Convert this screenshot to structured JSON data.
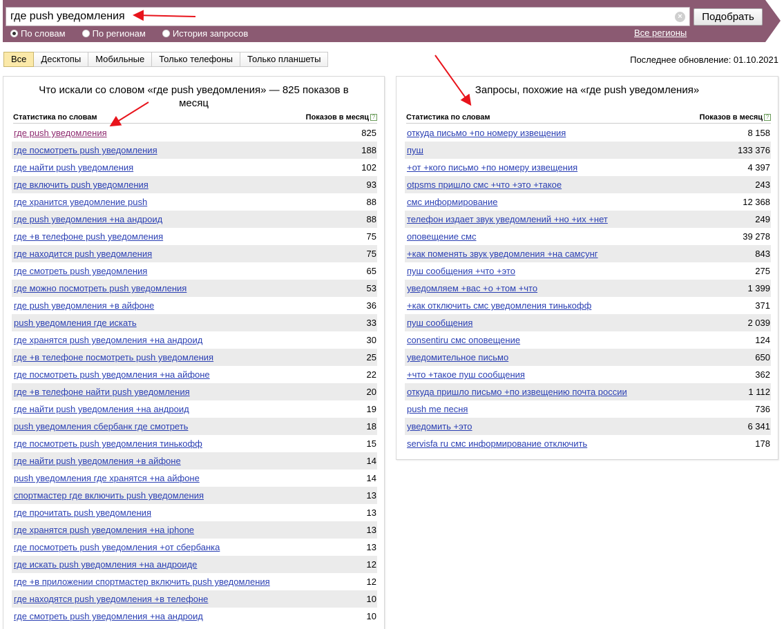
{
  "search": {
    "query": "где push уведомления",
    "clear_icon": "×",
    "submit_label": "Подобрать",
    "modes": [
      {
        "label": "По словам",
        "selected": true
      },
      {
        "label": "По регионам",
        "selected": false
      },
      {
        "label": "История запросов",
        "selected": false
      }
    ],
    "regions_label": "Все регионы"
  },
  "tabs": [
    "Все",
    "Десктопы",
    "Мобильные",
    "Только телефоны",
    "Только планшеты"
  ],
  "last_update": "Последнее обновление: 01.10.2021",
  "left": {
    "title": "Что искали со словом «где push уведомления» — 825 показов в месяц",
    "col_phrase": "Статистика по словам",
    "col_count": "Показов в месяц",
    "help": "?",
    "rows": [
      {
        "phrase": "где push уведомления",
        "count": "825"
      },
      {
        "phrase": "где посмотреть push уведомления",
        "count": "188"
      },
      {
        "phrase": "где найти push уведомления",
        "count": "102"
      },
      {
        "phrase": "где включить push уведомления",
        "count": "93"
      },
      {
        "phrase": "где хранится уведомление push",
        "count": "88"
      },
      {
        "phrase": "где push уведомления +на андроид",
        "count": "88"
      },
      {
        "phrase": "где +в телефоне push уведомления",
        "count": "75"
      },
      {
        "phrase": "где находится push уведомления",
        "count": "75"
      },
      {
        "phrase": "где смотреть push уведомления",
        "count": "65"
      },
      {
        "phrase": "где можно посмотреть push уведомления",
        "count": "53"
      },
      {
        "phrase": "где push уведомления +в айфоне",
        "count": "36"
      },
      {
        "phrase": "push уведомления где искать",
        "count": "33"
      },
      {
        "phrase": "где хранятся push уведомления +на андроид",
        "count": "30"
      },
      {
        "phrase": "где +в телефоне посмотреть push уведомления",
        "count": "25"
      },
      {
        "phrase": "где посмотреть push уведомления +на айфоне",
        "count": "22"
      },
      {
        "phrase": "где +в телефоне найти push уведомления",
        "count": "20"
      },
      {
        "phrase": "где найти push уведомления +на андроид",
        "count": "19"
      },
      {
        "phrase": "push уведомления сбербанк где смотреть",
        "count": "18"
      },
      {
        "phrase": "где посмотреть push уведомления тинькофф",
        "count": "15"
      },
      {
        "phrase": "где найти push уведомления +в айфоне",
        "count": "14"
      },
      {
        "phrase": "push уведомления где хранятся +на айфоне",
        "count": "14"
      },
      {
        "phrase": "спортмастер где включить push уведомления",
        "count": "13"
      },
      {
        "phrase": "где прочитать push уведомления",
        "count": "13"
      },
      {
        "phrase": "где хранятся push уведомления +на iphone",
        "count": "13"
      },
      {
        "phrase": "где посмотреть push уведомления +от сбербанка",
        "count": "13"
      },
      {
        "phrase": "где искать push уведомления +на андроиде",
        "count": "12"
      },
      {
        "phrase": "где +в приложении спортмастер включить push уведомления",
        "count": "12"
      },
      {
        "phrase": "где находятся push уведомления +в телефоне",
        "count": "10"
      },
      {
        "phrase": "где смотреть push уведомления +на андроид",
        "count": "10"
      }
    ]
  },
  "right": {
    "title": "Запросы, похожие на «где push уведомления»",
    "col_phrase": "Статистика по словам",
    "col_count": "Показов в месяц",
    "help": "?",
    "rows": [
      {
        "phrase": "откуда письмо +по номеру извещения",
        "count": "8 158"
      },
      {
        "phrase": "пуш",
        "count": "133 376"
      },
      {
        "phrase": "+от +кого письмо +по номеру извещения",
        "count": "4 397"
      },
      {
        "phrase": "otpsms пришло смс +что +это +такое",
        "count": "243"
      },
      {
        "phrase": "смс информирование",
        "count": "12 368"
      },
      {
        "phrase": "телефон издает звук уведомлений +но +их +нет",
        "count": "249"
      },
      {
        "phrase": "оповещение смс",
        "count": "39 278"
      },
      {
        "phrase": "+как поменять звук уведомления +на самсунг",
        "count": "843"
      },
      {
        "phrase": "пуш сообщения +что +это",
        "count": "275"
      },
      {
        "phrase": "уведомляем +вас +о +том +что",
        "count": "1 399"
      },
      {
        "phrase": "+как отключить смс уведомления тинькофф",
        "count": "371"
      },
      {
        "phrase": "пуш сообщения",
        "count": "2 039"
      },
      {
        "phrase": "consentiru смс оповещение",
        "count": "124"
      },
      {
        "phrase": "уведомительное письмо",
        "count": "650"
      },
      {
        "phrase": "+что +такое пуш сообщения",
        "count": "362"
      },
      {
        "phrase": "откуда пришло письмо +по извещению почта россии",
        "count": "1 112"
      },
      {
        "phrase": "push me песня",
        "count": "736"
      },
      {
        "phrase": "уведомить +это",
        "count": "6 341"
      },
      {
        "phrase": "servisfa ru смс информирование отключить",
        "count": "178"
      }
    ]
  },
  "colors": {
    "band": "#8b5a72",
    "link": "#2a3fb3",
    "visited_link": "#8e2a6f",
    "annotation_arrow": "#e8141c"
  }
}
